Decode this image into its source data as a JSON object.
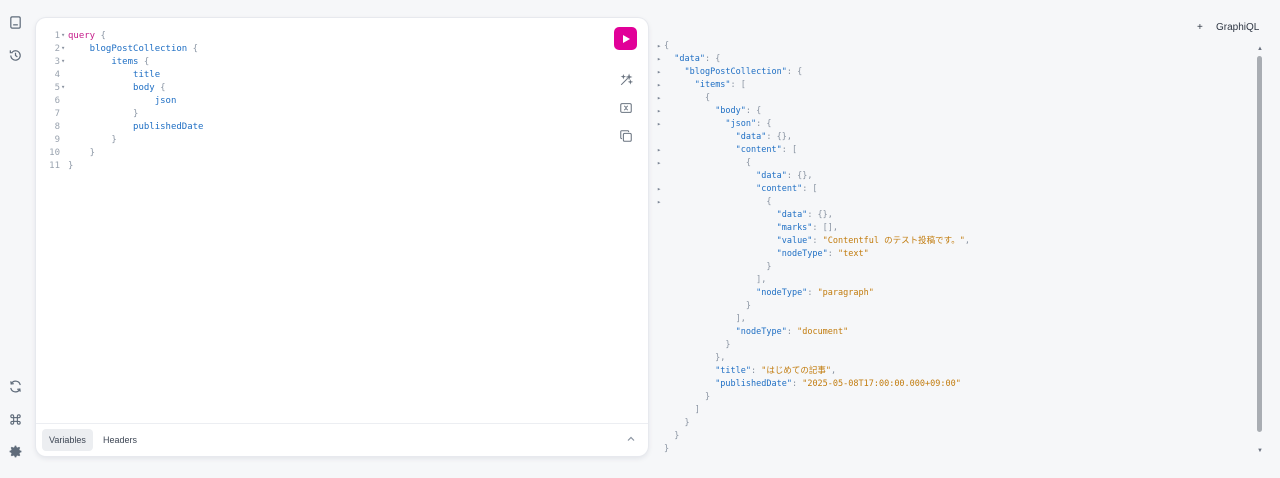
{
  "app": {
    "title": "GraphiQL"
  },
  "rail": {
    "icons": [
      "document-icon",
      "history-icon",
      "refresh-icon",
      "command-icon",
      "gear-icon"
    ]
  },
  "editor": {
    "lines": [
      {
        "n": "1",
        "fold": true,
        "segs": [
          {
            "t": "query",
            "c": "kw"
          },
          {
            "t": " {",
            "c": "pn"
          }
        ]
      },
      {
        "n": "2",
        "fold": true,
        "segs": [
          {
            "t": "    blogPostCollection",
            "c": "fld"
          },
          {
            "t": " {",
            "c": "pn"
          }
        ]
      },
      {
        "n": "3",
        "fold": true,
        "segs": [
          {
            "t": "        items",
            "c": "fld"
          },
          {
            "t": " {",
            "c": "pn"
          }
        ]
      },
      {
        "n": "4",
        "fold": false,
        "segs": [
          {
            "t": "            title",
            "c": "fld"
          }
        ]
      },
      {
        "n": "5",
        "fold": true,
        "segs": [
          {
            "t": "            body",
            "c": "fld"
          },
          {
            "t": " {",
            "c": "pn"
          }
        ]
      },
      {
        "n": "6",
        "fold": false,
        "segs": [
          {
            "t": "                json",
            "c": "fld"
          }
        ]
      },
      {
        "n": "7",
        "fold": false,
        "segs": [
          {
            "t": "            }",
            "c": "pn"
          }
        ]
      },
      {
        "n": "8",
        "fold": false,
        "segs": [
          {
            "t": "            publishedDate",
            "c": "fld"
          }
        ]
      },
      {
        "n": "9",
        "fold": false,
        "segs": [
          {
            "t": "        }",
            "c": "pn"
          }
        ]
      },
      {
        "n": "10",
        "fold": false,
        "segs": [
          {
            "t": "    }",
            "c": "pn"
          }
        ]
      },
      {
        "n": "11",
        "fold": false,
        "segs": [
          {
            "t": "}",
            "c": "pn"
          }
        ]
      }
    ],
    "tabs": [
      "Variables",
      "Headers"
    ]
  },
  "result": {
    "lines": [
      {
        "f": true,
        "segs": [
          {
            "t": "{",
            "c": "p"
          }
        ]
      },
      {
        "f": true,
        "segs": [
          {
            "t": "  ",
            "c": "p"
          },
          {
            "t": "\"data\"",
            "c": "k"
          },
          {
            "t": ": {",
            "c": "p"
          }
        ]
      },
      {
        "f": true,
        "segs": [
          {
            "t": "    ",
            "c": "p"
          },
          {
            "t": "\"blogPostCollection\"",
            "c": "k"
          },
          {
            "t": ": {",
            "c": "p"
          }
        ]
      },
      {
        "f": true,
        "segs": [
          {
            "t": "      ",
            "c": "p"
          },
          {
            "t": "\"items\"",
            "c": "k"
          },
          {
            "t": ": [",
            "c": "p"
          }
        ]
      },
      {
        "f": true,
        "segs": [
          {
            "t": "        {",
            "c": "p"
          }
        ]
      },
      {
        "f": true,
        "segs": [
          {
            "t": "          ",
            "c": "p"
          },
          {
            "t": "\"body\"",
            "c": "k"
          },
          {
            "t": ": {",
            "c": "p"
          }
        ]
      },
      {
        "f": true,
        "segs": [
          {
            "t": "            ",
            "c": "p"
          },
          {
            "t": "\"json\"",
            "c": "k"
          },
          {
            "t": ": {",
            "c": "p"
          }
        ]
      },
      {
        "f": false,
        "segs": [
          {
            "t": "              ",
            "c": "p"
          },
          {
            "t": "\"data\"",
            "c": "k"
          },
          {
            "t": ": {},",
            "c": "p"
          }
        ]
      },
      {
        "f": true,
        "segs": [
          {
            "t": "              ",
            "c": "p"
          },
          {
            "t": "\"content\"",
            "c": "k"
          },
          {
            "t": ": [",
            "c": "p"
          }
        ]
      },
      {
        "f": true,
        "segs": [
          {
            "t": "                {",
            "c": "p"
          }
        ]
      },
      {
        "f": false,
        "segs": [
          {
            "t": "                  ",
            "c": "p"
          },
          {
            "t": "\"data\"",
            "c": "k"
          },
          {
            "t": ": {},",
            "c": "p"
          }
        ]
      },
      {
        "f": true,
        "segs": [
          {
            "t": "                  ",
            "c": "p"
          },
          {
            "t": "\"content\"",
            "c": "k"
          },
          {
            "t": ": [",
            "c": "p"
          }
        ]
      },
      {
        "f": true,
        "segs": [
          {
            "t": "                    {",
            "c": "p"
          }
        ]
      },
      {
        "f": false,
        "segs": [
          {
            "t": "                      ",
            "c": "p"
          },
          {
            "t": "\"data\"",
            "c": "k"
          },
          {
            "t": ": {},",
            "c": "p"
          }
        ]
      },
      {
        "f": false,
        "segs": [
          {
            "t": "                      ",
            "c": "p"
          },
          {
            "t": "\"marks\"",
            "c": "k"
          },
          {
            "t": ": [],",
            "c": "p"
          }
        ]
      },
      {
        "f": false,
        "segs": [
          {
            "t": "                      ",
            "c": "p"
          },
          {
            "t": "\"value\"",
            "c": "k"
          },
          {
            "t": ": ",
            "c": "p"
          },
          {
            "t": "\"Contentful のテスト投稿です。\"",
            "c": "s"
          },
          {
            "t": ",",
            "c": "p"
          }
        ]
      },
      {
        "f": false,
        "segs": [
          {
            "t": "                      ",
            "c": "p"
          },
          {
            "t": "\"nodeType\"",
            "c": "k"
          },
          {
            "t": ": ",
            "c": "p"
          },
          {
            "t": "\"text\"",
            "c": "s"
          }
        ]
      },
      {
        "f": false,
        "segs": [
          {
            "t": "                    }",
            "c": "p"
          }
        ]
      },
      {
        "f": false,
        "segs": [
          {
            "t": "                  ],",
            "c": "p"
          }
        ]
      },
      {
        "f": false,
        "segs": [
          {
            "t": "                  ",
            "c": "p"
          },
          {
            "t": "\"nodeType\"",
            "c": "k"
          },
          {
            "t": ": ",
            "c": "p"
          },
          {
            "t": "\"paragraph\"",
            "c": "s"
          }
        ]
      },
      {
        "f": false,
        "segs": [
          {
            "t": "                }",
            "c": "p"
          }
        ]
      },
      {
        "f": false,
        "segs": [
          {
            "t": "              ],",
            "c": "p"
          }
        ]
      },
      {
        "f": false,
        "segs": [
          {
            "t": "              ",
            "c": "p"
          },
          {
            "t": "\"nodeType\"",
            "c": "k"
          },
          {
            "t": ": ",
            "c": "p"
          },
          {
            "t": "\"document\"",
            "c": "s"
          }
        ]
      },
      {
        "f": false,
        "segs": [
          {
            "t": "            }",
            "c": "p"
          }
        ]
      },
      {
        "f": false,
        "segs": [
          {
            "t": "          },",
            "c": "p"
          }
        ]
      },
      {
        "f": false,
        "segs": [
          {
            "t": "          ",
            "c": "p"
          },
          {
            "t": "\"title\"",
            "c": "k"
          },
          {
            "t": ": ",
            "c": "p"
          },
          {
            "t": "\"はじめての記事\"",
            "c": "s"
          },
          {
            "t": ",",
            "c": "p"
          }
        ]
      },
      {
        "f": false,
        "segs": [
          {
            "t": "          ",
            "c": "p"
          },
          {
            "t": "\"publishedDate\"",
            "c": "k"
          },
          {
            "t": ": ",
            "c": "p"
          },
          {
            "t": "\"2025-05-08T17:00:00.000+09:00\"",
            "c": "s"
          }
        ]
      },
      {
        "f": false,
        "segs": [
          {
            "t": "        }",
            "c": "p"
          }
        ]
      },
      {
        "f": false,
        "segs": [
          {
            "t": "      ]",
            "c": "p"
          }
        ]
      },
      {
        "f": false,
        "segs": [
          {
            "t": "    }",
            "c": "p"
          }
        ]
      },
      {
        "f": false,
        "segs": [
          {
            "t": "  }",
            "c": "p"
          }
        ]
      },
      {
        "f": false,
        "segs": [
          {
            "t": "}",
            "c": "p"
          }
        ]
      }
    ]
  },
  "header": {
    "plus_label": "+"
  },
  "colors": {
    "accent": "#e10098",
    "keyword": "#c51c8a",
    "field": "#1f6fc4",
    "string": "#c27c0e"
  }
}
